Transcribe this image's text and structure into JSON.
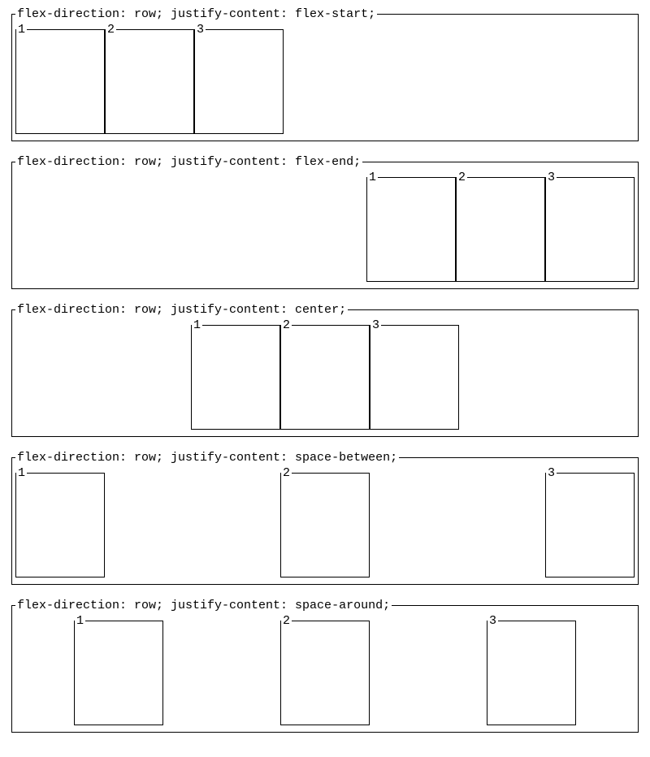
{
  "examples": [
    {
      "label": "flex-direction: row; justify-content: flex-start;",
      "justify": "flex-start",
      "items": [
        "1",
        "2",
        "3"
      ]
    },
    {
      "label": "flex-direction: row; justify-content: flex-end;",
      "justify": "flex-end",
      "items": [
        "1",
        "2",
        "3"
      ]
    },
    {
      "label": "flex-direction: row; justify-content: center;",
      "justify": "center",
      "items": [
        "1",
        "2",
        "3"
      ]
    },
    {
      "label": "flex-direction: row; justify-content: space-between;",
      "justify": "space-between",
      "items": [
        "1",
        "2",
        "3"
      ]
    },
    {
      "label": "flex-direction: row; justify-content: space-around;",
      "justify": "space-around",
      "items": [
        "1",
        "2",
        "3"
      ]
    }
  ]
}
